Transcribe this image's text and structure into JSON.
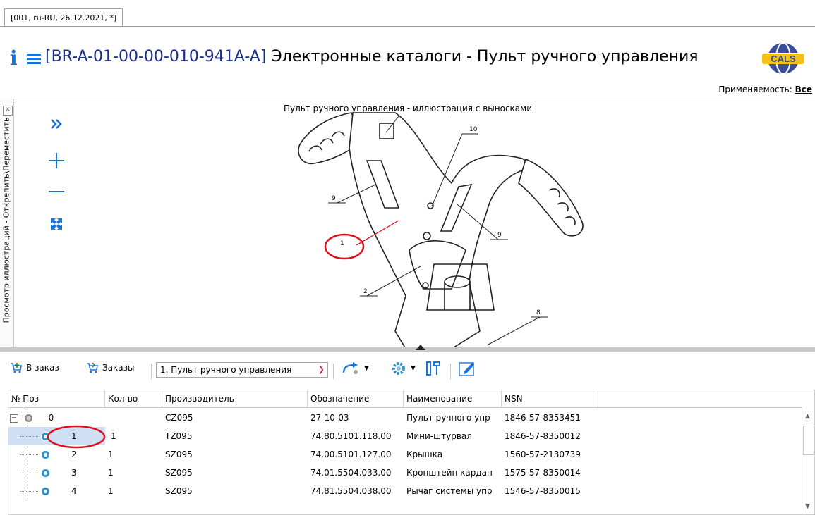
{
  "tab": {
    "label": "[001, ru-RU, 26.12.2021, *]"
  },
  "header": {
    "code": "[BR-A-01-00-00-010-941A-A]",
    "title": " Электронные каталоги - Пульт ручного управления",
    "logo_icon": "cals-globe-logo"
  },
  "applicability": {
    "label": "Применяемость:",
    "value": "Все"
  },
  "side_panel": {
    "label": "Просмотр иллюстраций - Открепить\\Переместить"
  },
  "viewer_tools": [
    "expand-right-icon",
    "zoom-in-icon",
    "zoom-out-icon",
    "fit-screen-icon"
  ],
  "illustration": {
    "caption": "Пульт ручного управления - иллюстрация с выносками",
    "callouts": [
      "10",
      "9",
      "9",
      "1",
      "2",
      "8"
    ]
  },
  "toolbar": {
    "to_order": "В заказ",
    "orders": "Заказы",
    "selected_item": "1. Пульт ручного управления"
  },
  "table": {
    "columns": [
      "№ Поз",
      "Кол-во",
      "Производитель",
      "Обозначение",
      "Наименование",
      "NSN"
    ],
    "rows": [
      {
        "pos": "0",
        "qty": "",
        "mfr": "CZ095",
        "designation": "27-10-03",
        "name": "Пульт ручного упр",
        "nsn": "1846-57-8353451"
      },
      {
        "pos": "1",
        "qty": "1",
        "mfr": "TZ095",
        "designation": "74.80.5101.118.00",
        "name": "Мини-штурвал",
        "nsn": "1846-57-8350012"
      },
      {
        "pos": "2",
        "qty": "1",
        "mfr": "SZ095",
        "designation": "74.00.5101.127.00",
        "name": "Крышка",
        "nsn": "1560-57-2130739"
      },
      {
        "pos": "3",
        "qty": "1",
        "mfr": "SZ095",
        "designation": "74.01.5504.033.00",
        "name": "Кронштейн кардан",
        "nsn": "1575-57-8350014"
      },
      {
        "pos": "4",
        "qty": "1",
        "mfr": "SZ095",
        "designation": "74.81.5504.038.00",
        "name": "Рычаг системы упр",
        "nsn": "1546-57-8350015"
      }
    ]
  },
  "colors": {
    "accent": "#1a73d9",
    "highlight": "#e0101a",
    "selected_row": "#cfe0f5"
  }
}
